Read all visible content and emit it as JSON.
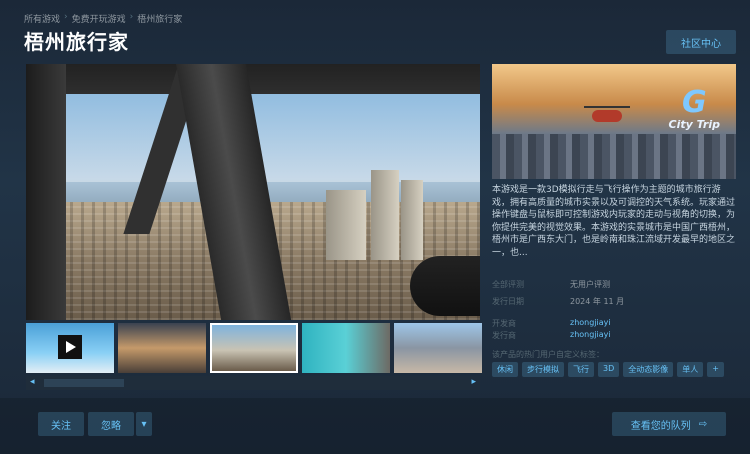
{
  "breadcrumb": [
    "所有游戏",
    "免费开玩游戏",
    "梧州旅行家"
  ],
  "title": "梧州旅行家",
  "community_button": "社区中心",
  "capsule": {
    "logo_text": "City Trip"
  },
  "description": "本游戏是一款3D模拟行走与飞行操作为主题的城市旅行游戏，拥有高质量的城市实景以及可调控的天气系统。玩家通过操作键盘与鼠标即可控制游戏内玩家的走动与视角的切换，为你提供完美的视觉效果。本游戏的实景城市是中国广西梧州，梧州市是广西东大门，也是岭南和珠江流域开发最早的地区之一，也...",
  "meta": [
    {
      "key": "全部评测",
      "value": "无用户评测"
    },
    {
      "key": "发行日期",
      "value": "2024 年 11 月"
    },
    {
      "key": "开发商",
      "value": "zhongjiayi",
      "link": true
    },
    {
      "key": "发行商",
      "value": "zhongjiayi",
      "link": true
    }
  ],
  "tags_label": "该产品的热门用户自定义标签：",
  "tags": [
    "休闲",
    "步行模拟",
    "飞行",
    "3D",
    "全动态影像",
    "单人",
    "+"
  ],
  "thumbnails": [
    "video",
    "screenshot",
    "screenshot-selected",
    "screenshot",
    "screenshot"
  ],
  "actions": {
    "follow": "关注",
    "ignore": "忽略",
    "dropdown": "▾",
    "queue": "查看您的队列",
    "queue_icon": "⇨"
  },
  "scroll": {
    "left": "◂",
    "right": "▸"
  },
  "colors": {
    "accent": "#67c1f5",
    "bg": "#1b2838"
  }
}
